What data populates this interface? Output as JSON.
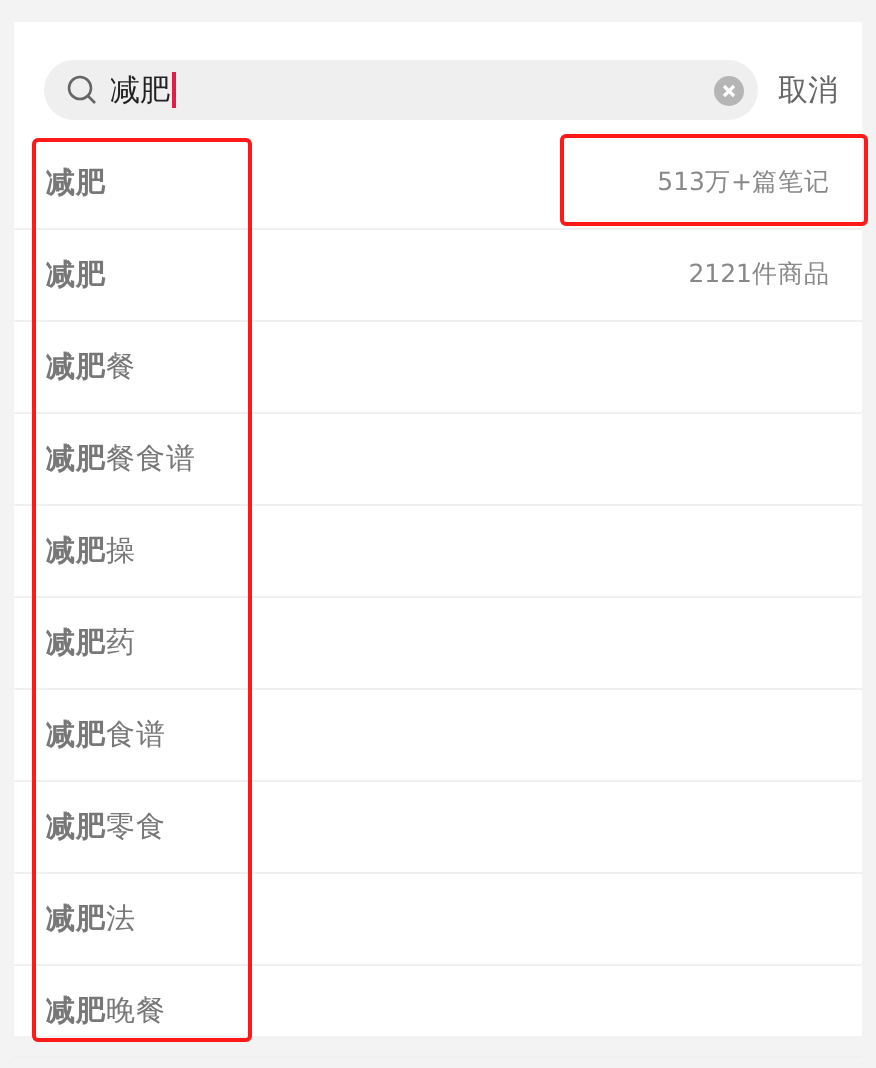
{
  "search": {
    "value": "减肥",
    "cancel": "取消"
  },
  "highlight_frames": {
    "suggestion_list": true,
    "first_count": true
  },
  "suggestions": [
    {
      "text": "**减肥**",
      "count": "513万+篇笔记"
    },
    {
      "text": "**减肥**",
      "count": "2121件商品"
    },
    {
      "text": "**减肥**餐"
    },
    {
      "text": "**减肥**餐食谱"
    },
    {
      "text": "**减肥**操"
    },
    {
      "text": "**减肥**药"
    },
    {
      "text": "**减肥**食谱"
    },
    {
      "text": "**减肥**零食"
    },
    {
      "text": "**减肥**法"
    },
    {
      "text": "**减肥**晚餐"
    }
  ]
}
